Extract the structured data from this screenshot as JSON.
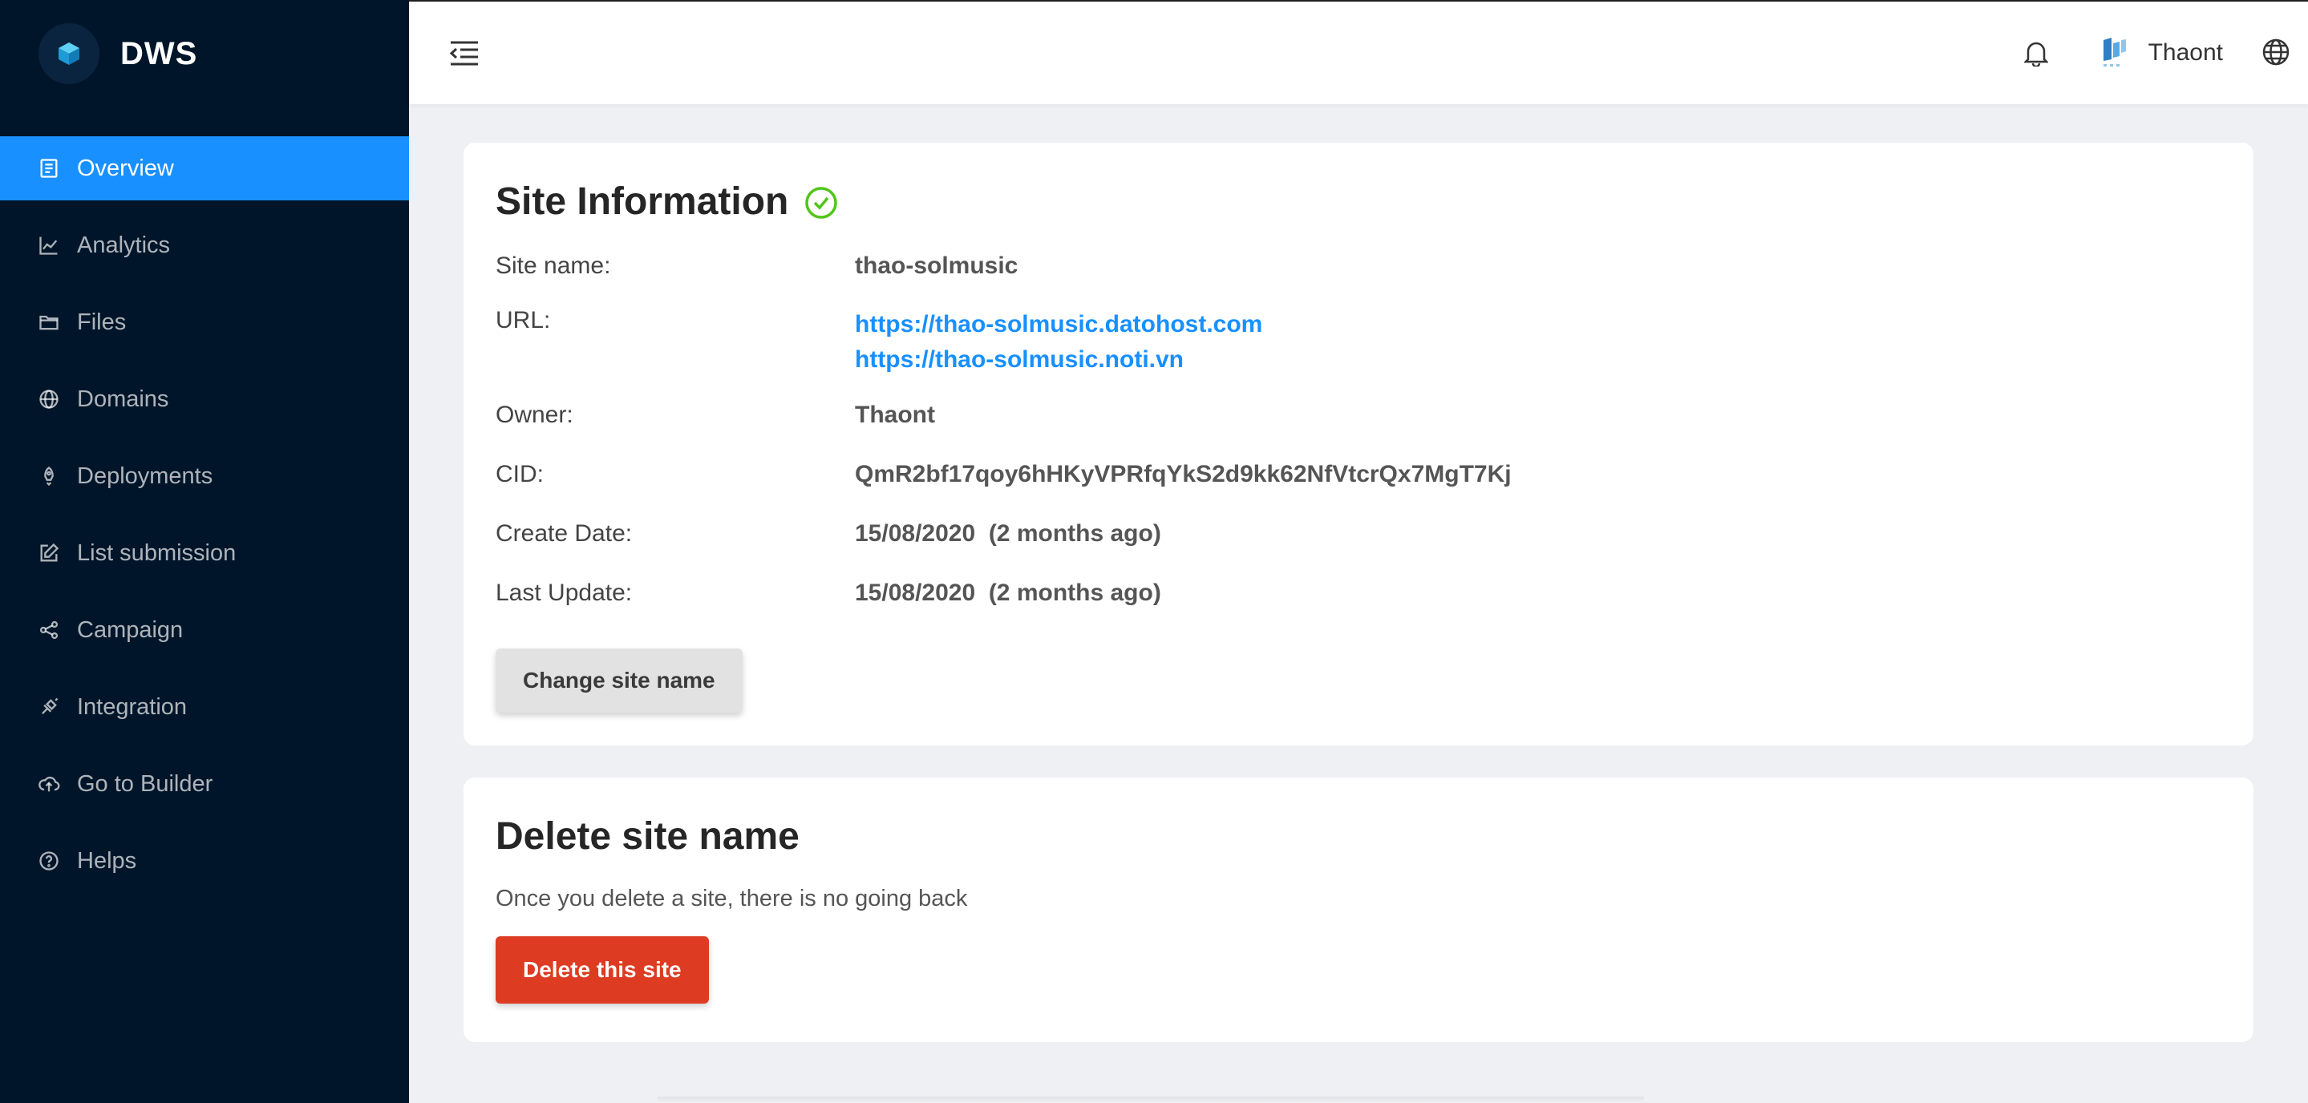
{
  "brand": {
    "name": "DWS"
  },
  "sidebar": {
    "items": [
      {
        "label": "Overview",
        "icon": "document-icon",
        "active": true
      },
      {
        "label": "Analytics",
        "icon": "line-chart-icon"
      },
      {
        "label": "Files",
        "icon": "folder-icon"
      },
      {
        "label": "Domains",
        "icon": "globe-icon"
      },
      {
        "label": "Deployments",
        "icon": "rocket-icon"
      },
      {
        "label": "List submission",
        "icon": "edit-icon"
      },
      {
        "label": "Campaign",
        "icon": "share-icon"
      },
      {
        "label": "Integration",
        "icon": "api-icon"
      },
      {
        "label": "Go to Builder",
        "icon": "cloud-upload-icon"
      },
      {
        "label": "Helps",
        "icon": "question-circle-icon"
      }
    ]
  },
  "header": {
    "username": "Thaont"
  },
  "site_info": {
    "title": "Site Information",
    "labels": {
      "site_name": "Site name:",
      "url": "URL:",
      "owner": "Owner:",
      "cid": "CID:",
      "create_date": "Create Date:",
      "last_update": "Last Update:"
    },
    "values": {
      "site_name": "thao-solmusic",
      "url_1": "https://thao-solmusic.datohost.com",
      "url_2": "https://thao-solmusic.noti.vn",
      "owner": "Thaont",
      "cid": "QmR2bf17qoy6hHKyVPRfqYkS2d9kk62NfVtcrQx7MgT7Kj",
      "create_date": "15/08/2020  (2 months ago)",
      "last_update": "15/08/2020  (2 months ago)"
    },
    "change_button": "Change site name"
  },
  "delete_site": {
    "title": "Delete site name",
    "description": "Once you delete a site, there is no going back",
    "delete_button": "Delete this site"
  },
  "colors": {
    "sidebar_bg": "#001529",
    "accent": "#1890ff",
    "danger": "#dd3b22",
    "success": "#52c41a"
  }
}
